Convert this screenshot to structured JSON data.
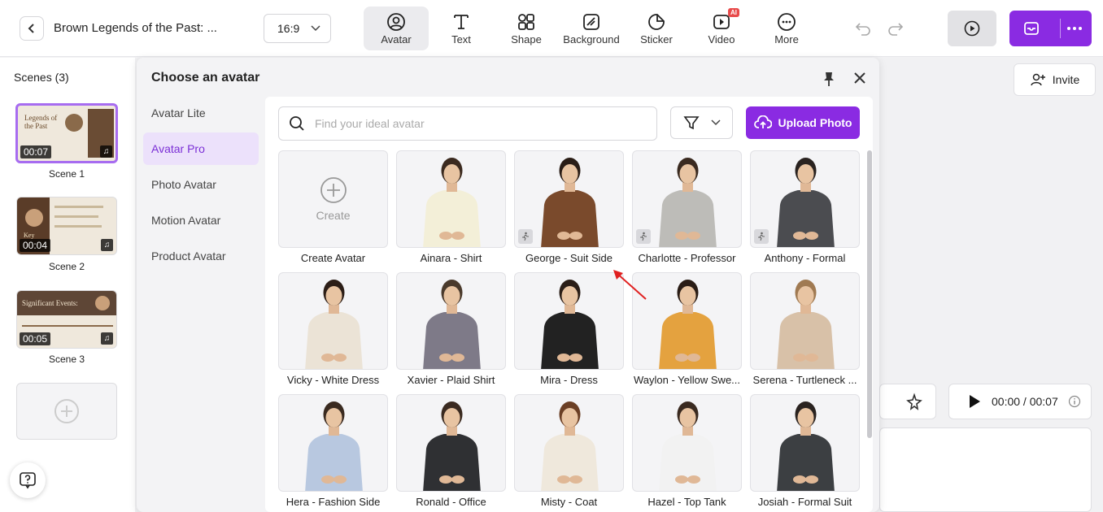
{
  "header": {
    "title": "Brown Legends of the Past: ...",
    "ratio": "16:9",
    "tools": [
      {
        "label": "Avatar",
        "icon": "avatar-icon",
        "active": true
      },
      {
        "label": "Text",
        "icon": "text-icon"
      },
      {
        "label": "Shape",
        "icon": "shape-icon"
      },
      {
        "label": "Background",
        "icon": "background-icon"
      },
      {
        "label": "Sticker",
        "icon": "sticker-icon"
      },
      {
        "label": "Video",
        "icon": "video-icon",
        "badge": "AI"
      },
      {
        "label": "More",
        "icon": "more-icon"
      }
    ]
  },
  "scenes": {
    "title": "Scenes (3)",
    "items": [
      {
        "label": "Scene 1",
        "duration": "00:07",
        "thumb_text": "Legends of the Past"
      },
      {
        "label": "Scene 2",
        "duration": "00:04",
        "thumb_text": "Key"
      },
      {
        "label": "Scene 3",
        "duration": "00:05",
        "thumb_text": "Significant Events:"
      }
    ]
  },
  "panel": {
    "title": "Choose an avatar",
    "categories": [
      "Avatar Lite",
      "Avatar Pro",
      "Photo Avatar",
      "Motion Avatar",
      "Product Avatar"
    ],
    "active_category": "Avatar Pro",
    "search_placeholder": "Find your ideal avatar",
    "upload_label": "Upload Photo",
    "create_label": "Create",
    "avatars": [
      {
        "name": "Create Avatar"
      },
      {
        "name": "Ainara - Shirt",
        "shirt": "#f3efd8",
        "hair": "#3b2a1f",
        "motion": false
      },
      {
        "name": "George - Suit Side",
        "shirt": "#7a4a2c",
        "hair": "#2a1d16",
        "motion": true
      },
      {
        "name": "Charlotte - Professor",
        "shirt": "#bdbcb8",
        "hair": "#3a2a20",
        "motion": true
      },
      {
        "name": "Anthony - Formal",
        "shirt": "#4b4c50",
        "hair": "#2a2320",
        "motion": true
      },
      {
        "name": "Vicky - White Dress",
        "shirt": "#ebe3d6",
        "hair": "#2c1e17",
        "motion": false
      },
      {
        "name": "Xavier - Plaid Shirt",
        "shirt": "#7e7a88",
        "hair": "#4a3a2c",
        "motion": false
      },
      {
        "name": "Mira - Dress",
        "shirt": "#222222",
        "hair": "#2a1d16",
        "motion": false
      },
      {
        "name": "Waylon - Yellow Swe...",
        "shirt": "#e4a23f",
        "hair": "#2a1d16",
        "motion": false
      },
      {
        "name": "Serena - Turtleneck ...",
        "shirt": "#d8c1a8",
        "hair": "#a07a52",
        "motion": false
      },
      {
        "name": "Hera - Fashion Side",
        "shirt": "#b8c8e0",
        "hair": "#3a2a20",
        "motion": false
      },
      {
        "name": "Ronald - Office",
        "shirt": "#2f3033",
        "hair": "#3a2a20",
        "motion": false
      },
      {
        "name": "Misty - Coat",
        "shirt": "#efe8dc",
        "hair": "#6b3f25",
        "motion": false
      },
      {
        "name": "Hazel - Top Tank",
        "shirt": "#f2f2f2",
        "hair": "#3a2a20",
        "motion": false
      },
      {
        "name": "Josiah - Formal Suit",
        "shirt": "#3c3f42",
        "hair": "#2a2320",
        "motion": false
      }
    ]
  },
  "right": {
    "invite_label": "Invite",
    "time": "00:00 / 00:07"
  },
  "colors": {
    "accent": "#8a2be2"
  }
}
